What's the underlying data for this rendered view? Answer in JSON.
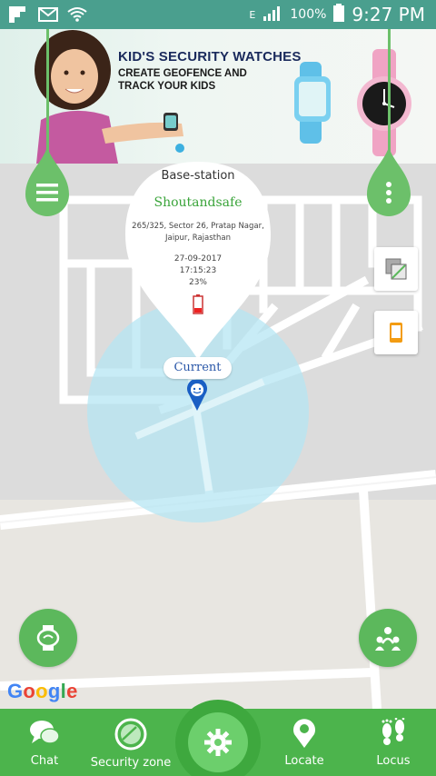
{
  "status_bar": {
    "network_type": "E",
    "battery": "100%",
    "time": "9:27 PM",
    "left_icons": [
      "flipboard-icon",
      "gmail-icon",
      "wifi-icon"
    ],
    "bg_color": "#4a9f8e"
  },
  "banner": {
    "title": "KID'S SECURITY WATCHES",
    "subtitle": "CREATE GEOFENCE AND TRACK YOUR KIDS"
  },
  "popup": {
    "title": "Base-station",
    "name": "Shoutandsafe",
    "address": "265/325, Sector 26, Pratap Nagar, Jaipur, Rajasthan",
    "date": "27-09-2017",
    "time": "17:15:23",
    "battery": "23%"
  },
  "map": {
    "current_label": "Current",
    "google_text": [
      "G",
      "o",
      "o",
      "g",
      "l",
      "e"
    ],
    "google_colors": [
      "#4285f4",
      "#ea4335",
      "#fbbc05",
      "#4285f4",
      "#34a853",
      "#ea4335"
    ]
  },
  "bottom_nav": {
    "items": [
      {
        "label": "Chat",
        "icon": "chat-icon"
      },
      {
        "label": "Security zone",
        "icon": "security-zone-icon"
      },
      {
        "label": "Settings",
        "icon": "gear-icon"
      },
      {
        "label": "Locate",
        "icon": "location-pin-icon"
      },
      {
        "label": "Locus",
        "icon": "footprints-icon"
      }
    ],
    "accent": "#4cb44c"
  }
}
